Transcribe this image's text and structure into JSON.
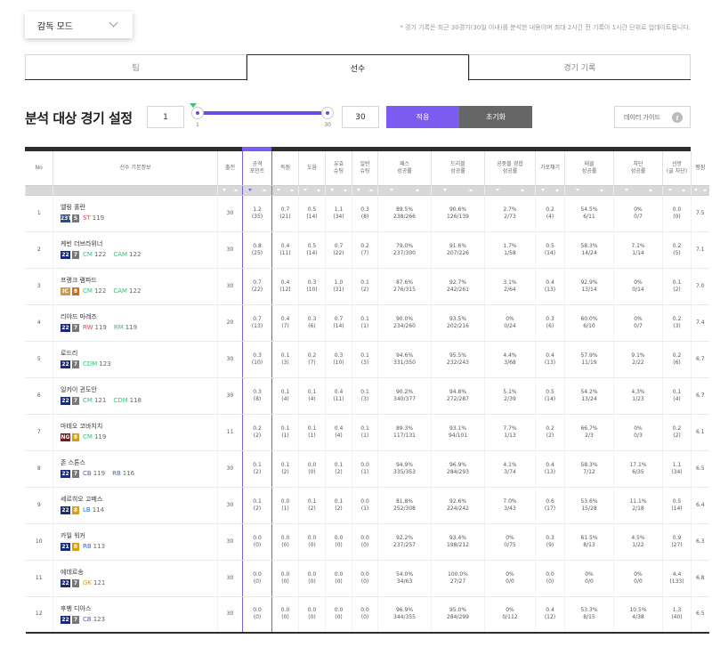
{
  "mode_select": {
    "label": "감독 모드"
  },
  "notice": "* 경기 기록은 최근 30경기(30일 이내)를 분석한 내용이며 최대 2시간 전 기록이 1시간 단위로 업데이트됩니다.",
  "tabs": [
    "팀",
    "선수",
    "경기 기록"
  ],
  "settings": {
    "title": "분석 대상 경기 설정",
    "min_value": "1",
    "max_value": "30",
    "slider_min_label": "1",
    "slider_max_label": "30",
    "apply_label": "적용",
    "reset_label": "초기화",
    "guide_label": "데이터 가이드",
    "guide_icon": "i"
  },
  "colors": {
    "accent": "#7b5cf0",
    "dark": "#2d2d2d",
    "green": "#3ac07a",
    "red": "#e8454b",
    "orange": "#e8941a"
  },
  "headers": [
    "No",
    "선수 기본정보",
    "출전",
    "공격\n포인트",
    "득점",
    "도움",
    "유효\n슈팅",
    "일반\n슈팅",
    "패스\n성공률",
    "드리블\n성공률",
    "공중볼 경합\n성공률",
    "가로채기",
    "태클\n성공률",
    "차단\n성공률",
    "선방\n(골 차단)",
    "평점"
  ],
  "rows": [
    {
      "no": "1",
      "name": "엘링 홀란",
      "season": "23TY",
      "season_color": "#2b4a8c",
      "grade": "5",
      "grade_color": "#777",
      "positions": [
        {
          "pos": "ST",
          "ovr": "119",
          "color": "#e8454b"
        }
      ],
      "games": "30",
      "ap": [
        "1.2",
        "(35)"
      ],
      "goals": [
        "0.7",
        "(21)"
      ],
      "assists": [
        "0.5",
        "(14)"
      ],
      "sot": [
        "1.1",
        "(34)"
      ],
      "shots": [
        "0.3",
        "(8)"
      ],
      "pass": [
        "89.5%",
        "238/266"
      ],
      "dribble": [
        "90.6%",
        "126/139"
      ],
      "aerial": [
        "2.7%",
        "2/73"
      ],
      "intercept": [
        "0.2",
        "(4)"
      ],
      "tackle": [
        "54.5%",
        "6/11"
      ],
      "block": [
        "0%",
        "0/7"
      ],
      "save": [
        "0.0",
        "(0)"
      ],
      "rating": "7.5"
    },
    {
      "no": "2",
      "name": "케빈 더브라위너",
      "season": "22",
      "season_color": "#1a2a7a",
      "grade": "7",
      "grade_color": "#777",
      "positions": [
        {
          "pos": "CM",
          "ovr": "122",
          "color": "#3ac07a"
        },
        {
          "pos": "CAM",
          "ovr": "122",
          "color": "#3ac07a"
        }
      ],
      "games": "30",
      "ap": [
        "0.8",
        "(25)"
      ],
      "goals": [
        "0.4",
        "(11)"
      ],
      "assists": [
        "0.5",
        "(14)"
      ],
      "sot": [
        "0.7",
        "(22)"
      ],
      "shots": [
        "0.2",
        "(7)"
      ],
      "pass": [
        "79.0%",
        "237/300"
      ],
      "dribble": [
        "91.6%",
        "207/226"
      ],
      "aerial": [
        "1.7%",
        "1/58"
      ],
      "intercept": [
        "0.5",
        "(14)"
      ],
      "tackle": [
        "58.3%",
        "14/24"
      ],
      "block": [
        "7.1%",
        "1/14"
      ],
      "save": [
        "0.2",
        "(5)"
      ],
      "rating": "7.1"
    },
    {
      "no": "3",
      "name": "프랭크 램파드",
      "season": "IC",
      "season_color": "#c99a5a",
      "grade": "8",
      "grade_color": "#c07020",
      "positions": [
        {
          "pos": "CM",
          "ovr": "122",
          "color": "#3ac07a"
        },
        {
          "pos": "CAM",
          "ovr": "122",
          "color": "#3ac07a"
        }
      ],
      "games": "30",
      "ap": [
        "0.7",
        "(22)"
      ],
      "goals": [
        "0.4",
        "(12)"
      ],
      "assists": [
        "0.3",
        "(10)"
      ],
      "sot": [
        "1.0",
        "(31)"
      ],
      "shots": [
        "0.1",
        "(2)"
      ],
      "pass": [
        "87.6%",
        "276/315"
      ],
      "dribble": [
        "92.7%",
        "242/261"
      ],
      "aerial": [
        "3.1%",
        "2/64"
      ],
      "intercept": [
        "0.4",
        "(13)"
      ],
      "tackle": [
        "92.9%",
        "13/14"
      ],
      "block": [
        "0%",
        "0/14"
      ],
      "save": [
        "0.1",
        "(2)"
      ],
      "rating": "7.0"
    },
    {
      "no": "4",
      "name": "리야드 마레즈",
      "season": "22",
      "season_color": "#1a2a7a",
      "grade": "7",
      "grade_color": "#777",
      "positions": [
        {
          "pos": "RW",
          "ovr": "119",
          "color": "#e8454b"
        },
        {
          "pos": "RM",
          "ovr": "119",
          "color": "#3ac07a"
        }
      ],
      "games": "20",
      "ap": [
        "0.7",
        "(13)"
      ],
      "goals": [
        "0.4",
        "(7)"
      ],
      "assists": [
        "0.3",
        "(6)"
      ],
      "sot": [
        "0.7",
        "(14)"
      ],
      "shots": [
        "0.1",
        "(1)"
      ],
      "pass": [
        "90.0%",
        "234/260"
      ],
      "dribble": [
        "93.5%",
        "202/216"
      ],
      "aerial": [
        "0%",
        "0/24"
      ],
      "intercept": [
        "0.3",
        "(6)"
      ],
      "tackle": [
        "60.0%",
        "6/10"
      ],
      "block": [
        "0%",
        "0/7"
      ],
      "save": [
        "0.2",
        "(3)"
      ],
      "rating": "7.4"
    },
    {
      "no": "5",
      "name": "로드리",
      "season": "22",
      "season_color": "#1a2a7a",
      "grade": "7",
      "grade_color": "#777",
      "positions": [
        {
          "pos": "CDM",
          "ovr": "123",
          "color": "#3ac07a"
        }
      ],
      "games": "30",
      "ap": [
        "0.3",
        "(10)"
      ],
      "goals": [
        "0.1",
        "(3)"
      ],
      "assists": [
        "0.2",
        "(7)"
      ],
      "sot": [
        "0.3",
        "(10)"
      ],
      "shots": [
        "0.1",
        "(3)"
      ],
      "pass": [
        "94.6%",
        "331/350"
      ],
      "dribble": [
        "95.5%",
        "232/243"
      ],
      "aerial": [
        "4.4%",
        "3/68"
      ],
      "intercept": [
        "0.4",
        "(13)"
      ],
      "tackle": [
        "57.9%",
        "11/19"
      ],
      "block": [
        "9.1%",
        "2/22"
      ],
      "save": [
        "0.2",
        "(6)"
      ],
      "rating": "6.7"
    },
    {
      "no": "6",
      "name": "일카이 귄도안",
      "season": "22",
      "season_color": "#1a2a7a",
      "grade": "7",
      "grade_color": "#777",
      "positions": [
        {
          "pos": "CM",
          "ovr": "121",
          "color": "#3ac07a"
        },
        {
          "pos": "CDM",
          "ovr": "118",
          "color": "#3ac07a"
        }
      ],
      "games": "30",
      "ap": [
        "0.3",
        "(8)"
      ],
      "goals": [
        "0.1",
        "(4)"
      ],
      "assists": [
        "0.1",
        "(4)"
      ],
      "sot": [
        "0.4",
        "(11)"
      ],
      "shots": [
        "0.1",
        "(3)"
      ],
      "pass": [
        "90.2%",
        "340/377"
      ],
      "dribble": [
        "94.8%",
        "272/287"
      ],
      "aerial": [
        "5.1%",
        "2/39"
      ],
      "intercept": [
        "0.5",
        "(14)"
      ],
      "tackle": [
        "54.2%",
        "13/24"
      ],
      "block": [
        "4.3%",
        "1/23"
      ],
      "save": [
        "0.1",
        "(4)"
      ],
      "rating": "6.7"
    },
    {
      "no": "7",
      "name": "마테오 코바치치",
      "season": "NG",
      "season_color": "#7a1a1a",
      "grade": "8",
      "grade_color": "#d4a010",
      "positions": [
        {
          "pos": "CM",
          "ovr": "119",
          "color": "#3ac07a"
        }
      ],
      "games": "11",
      "ap": [
        "0.2",
        "(2)"
      ],
      "goals": [
        "0.1",
        "(1)"
      ],
      "assists": [
        "0.1",
        "(1)"
      ],
      "sot": [
        "0.4",
        "(4)"
      ],
      "shots": [
        "0.1",
        "(1)"
      ],
      "pass": [
        "89.3%",
        "117/131"
      ],
      "dribble": [
        "93.1%",
        "94/101"
      ],
      "aerial": [
        "7.7%",
        "1/13"
      ],
      "intercept": [
        "0.2",
        "(2)"
      ],
      "tackle": [
        "66.7%",
        "2/3"
      ],
      "block": [
        "0%",
        "0/3"
      ],
      "save": [
        "0.2",
        "(2)"
      ],
      "rating": "6.1"
    },
    {
      "no": "8",
      "name": "존 스톤스",
      "season": "22",
      "season_color": "#1a2a7a",
      "grade": "7",
      "grade_color": "#777",
      "positions": [
        {
          "pos": "CB",
          "ovr": "119",
          "color": "#2b6ae8"
        },
        {
          "pos": "RB",
          "ovr": "116",
          "color": "#2b6ae8"
        }
      ],
      "games": "30",
      "ap": [
        "0.1",
        "(2)"
      ],
      "goals": [
        "0.1",
        "(2)"
      ],
      "assists": [
        "0.0",
        "(0)"
      ],
      "sot": [
        "0.1",
        "(2)"
      ],
      "shots": [
        "0.0",
        "(1)"
      ],
      "pass": [
        "94.9%",
        "335/353"
      ],
      "dribble": [
        "96.9%",
        "284/293"
      ],
      "aerial": [
        "4.1%",
        "3/74"
      ],
      "intercept": [
        "0.4",
        "(13)"
      ],
      "tackle": [
        "58.3%",
        "7/12"
      ],
      "block": [
        "17.1%",
        "6/35"
      ],
      "save": [
        "1.1",
        "(34)"
      ],
      "rating": "6.5"
    },
    {
      "no": "9",
      "name": "세르히오 고메스",
      "season": "22",
      "season_color": "#1a2a7a",
      "grade": "8",
      "grade_color": "#d4a010",
      "positions": [
        {
          "pos": "LB",
          "ovr": "114",
          "color": "#2b6ae8"
        }
      ],
      "games": "30",
      "ap": [
        "0.1",
        "(2)"
      ],
      "goals": [
        "0.0",
        "(1)"
      ],
      "assists": [
        "0.1",
        "(2)"
      ],
      "sot": [
        "0.1",
        "(2)"
      ],
      "shots": [
        "0.0",
        "(1)"
      ],
      "pass": [
        "81.8%",
        "252/308"
      ],
      "dribble": [
        "92.6%",
        "224/242"
      ],
      "aerial": [
        "7.0%",
        "3/43"
      ],
      "intercept": [
        "0.6",
        "(17)"
      ],
      "tackle": [
        "53.6%",
        "15/28"
      ],
      "block": [
        "11.1%",
        "2/18"
      ],
      "save": [
        "0.5",
        "(14)"
      ],
      "rating": "6.4"
    },
    {
      "no": "10",
      "name": "카일 워커",
      "season": "21",
      "season_color": "#1a2a7a",
      "grade": "8",
      "grade_color": "#d4a010",
      "positions": [
        {
          "pos": "RB",
          "ovr": "113",
          "color": "#2b6ae8"
        }
      ],
      "games": "30",
      "ap": [
        "0.0",
        "(0)"
      ],
      "goals": [
        "0.0",
        "(0)"
      ],
      "assists": [
        "0.0",
        "(0)"
      ],
      "sot": [
        "0.0",
        "(0)"
      ],
      "shots": [
        "0.0",
        "(0)"
      ],
      "pass": [
        "92.2%",
        "237/257"
      ],
      "dribble": [
        "93.4%",
        "198/212"
      ],
      "aerial": [
        "0%",
        "0/75"
      ],
      "intercept": [
        "0.3",
        "(9)"
      ],
      "tackle": [
        "61.5%",
        "8/13"
      ],
      "block": [
        "4.5%",
        "1/22"
      ],
      "save": [
        "0.9",
        "(27)"
      ],
      "rating": "6.3"
    },
    {
      "no": "11",
      "name": "에데르송",
      "season": "22",
      "season_color": "#1a2a7a",
      "grade": "7",
      "grade_color": "#777",
      "positions": [
        {
          "pos": "GK",
          "ovr": "121",
          "color": "#e8941a"
        }
      ],
      "games": "30",
      "ap": [
        "0.0",
        "(0)"
      ],
      "goals": [
        "0.0",
        "(0)"
      ],
      "assists": [
        "0.0",
        "(0)"
      ],
      "sot": [
        "0.0",
        "(0)"
      ],
      "shots": [
        "0.0",
        "(0)"
      ],
      "pass": [
        "54.0%",
        "34/63"
      ],
      "dribble": [
        "100.0%",
        "27/27"
      ],
      "aerial": [
        "0%",
        "0/0"
      ],
      "intercept": [
        "0.0",
        "(0)"
      ],
      "tackle": [
        "0%",
        "0/0"
      ],
      "block": [
        "0%",
        "0/0"
      ],
      "save": [
        "4.4",
        "(133)"
      ],
      "rating": "6.8"
    },
    {
      "no": "12",
      "name": "후벵 디아스",
      "season": "22",
      "season_color": "#1a2a7a",
      "grade": "7",
      "grade_color": "#777",
      "positions": [
        {
          "pos": "CB",
          "ovr": "123",
          "color": "#2b6ae8"
        }
      ],
      "games": "30",
      "ap": [
        "0.0",
        "(0)"
      ],
      "goals": [
        "0.0",
        "(0)"
      ],
      "assists": [
        "0.0",
        "(0)"
      ],
      "sot": [
        "0.0",
        "(0)"
      ],
      "shots": [
        "0.0",
        "(0)"
      ],
      "pass": [
        "96.9%",
        "344/355"
      ],
      "dribble": [
        "95.0%",
        "284/299"
      ],
      "aerial": [
        "0%",
        "0/112"
      ],
      "intercept": [
        "0.4",
        "(12)"
      ],
      "tackle": [
        "53.3%",
        "8/15"
      ],
      "block": [
        "10.5%",
        "4/38"
      ],
      "save": [
        "1.3",
        "(40)"
      ],
      "rating": "6.5"
    }
  ]
}
